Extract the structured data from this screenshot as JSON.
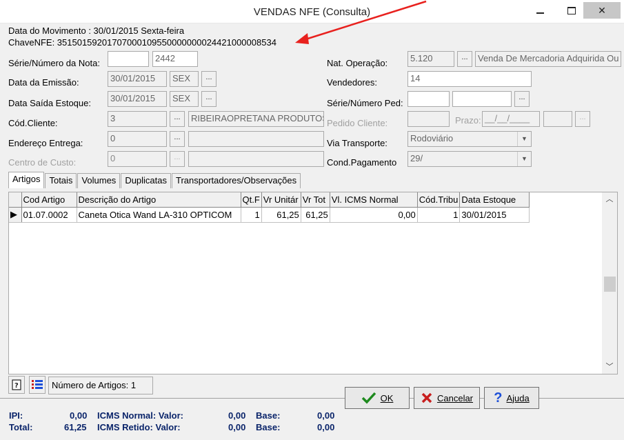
{
  "window": {
    "title": "VENDAS NFE (Consulta)"
  },
  "info": {
    "movimento": "Data do Movimento : 30/01/2015  Sexta-feira",
    "chave": "ChaveNFE: 35150159201707000109550000000024421000008534"
  },
  "labels": {
    "serie_numero": "Série/Número da Nota:",
    "data_emissao": "Data da Emissão:",
    "data_saida": "Data Saída Estoque:",
    "cod_cliente": "Cód.Cliente:",
    "endereco": "Endereço Entrega:",
    "centro_custo": "Centro de Custo:",
    "nat_operacao": "Nat. Operação:",
    "vendedores": "Vendedores:",
    "serie_ped": "Série/Número Ped:",
    "pedido_cliente": "Pedido Cliente:",
    "prazo": "Prazo:",
    "via_transporte": "Via Transporte:",
    "cond_pagamento": "Cond.Pagamento"
  },
  "fields": {
    "serie": "",
    "numero": "2442",
    "data_emissao": "30/01/2015",
    "data_emissao_dia": "SEX",
    "data_saida": "30/01/2015",
    "data_saida_dia": "SEX",
    "cod_cliente": "3",
    "cliente_nome": "RIBEIRAOPRETANA PRODUTOS",
    "endereco_cod": "0",
    "endereco_desc": "",
    "centro_cod": "0",
    "centro_desc": "",
    "nat_operacao": "5.120",
    "nat_operacao_desc": "Venda De Mercadoria Adquirida Ou",
    "vendedores": "14",
    "serie_ped": "",
    "numero_ped": "",
    "pedido_cliente": "",
    "prazo": "__/__/____",
    "via_transporte": "Rodoviário",
    "cond_pagamento": "29/"
  },
  "dots_label": "...",
  "tabs": [
    "Artigos",
    "Totais",
    "Volumes",
    "Duplicatas",
    "Transportadores/Observações"
  ],
  "grid": {
    "columns": [
      "Cod Artigo",
      "Descrição do Artigo",
      "Qt.F",
      "Vr Unitár",
      "Vr Tot",
      "Vl. ICMS Normal",
      "Cód.Tribu",
      "Data Estoque"
    ],
    "rows": [
      [
        "01.07.0002",
        "Caneta Otica Wand LA-310 OPTICOM",
        "1",
        "61,25",
        "61,25",
        "0,00",
        "1",
        "30/01/2015"
      ]
    ],
    "row_indicator": "▶"
  },
  "status": {
    "artigos": "Número de Artigos: 1"
  },
  "totals": {
    "ipi_label": "IPI:",
    "ipi_value": "0,00",
    "total_label": "Total:",
    "total_value": "61,25",
    "icms_normal_label": "ICMS Normal: Valor:",
    "icms_normal_value": "0,00",
    "icms_retido_label": "ICMS Retido: Valor:",
    "icms_retido_value": "0,00",
    "base_label": "Base:",
    "base1_value": "0,00",
    "base2_value": "0,00"
  },
  "buttons": {
    "ok": "OK",
    "cancelar": "Cancelar",
    "ajuda": "Ajuda"
  },
  "colors": {
    "annotation_arrow": "#e8211e",
    "totals_text": "#0a246a",
    "ok_icon": "#1e8a1e",
    "cancel_icon": "#c81e1e",
    "help_icon": "#1c4fd8"
  }
}
